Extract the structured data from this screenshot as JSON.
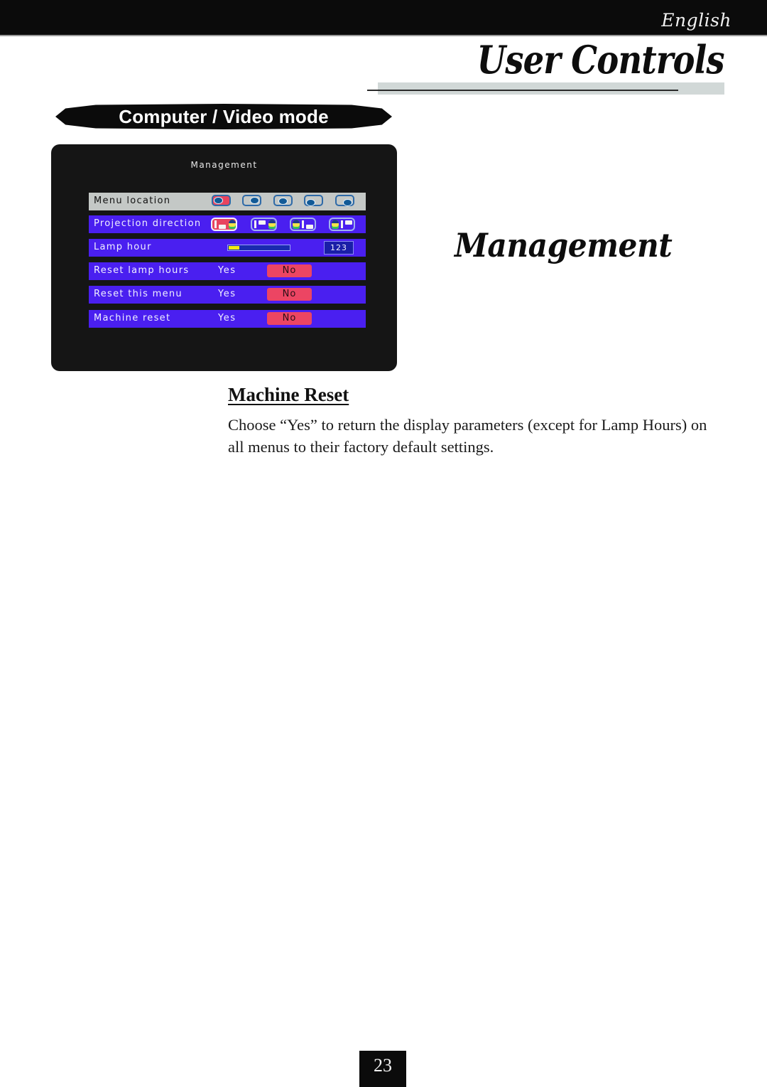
{
  "header": {
    "language": "English",
    "section_title": "User Controls"
  },
  "mode_banner": "Computer / Video mode",
  "osd": {
    "title": "Management",
    "rows": [
      {
        "label": "Menu location",
        "type": "icon-options",
        "selected": true,
        "options": [
          {
            "icon": "menu-location-top-left-icon",
            "active": true
          },
          {
            "icon": "menu-location-top-right-icon",
            "active": false
          },
          {
            "icon": "menu-location-center-icon",
            "active": false
          },
          {
            "icon": "menu-location-bottom-left-icon",
            "active": false
          },
          {
            "icon": "menu-location-bottom-right-icon",
            "active": false
          }
        ]
      },
      {
        "label": "Projection direction",
        "type": "icon-options",
        "selected": false,
        "options": [
          {
            "icon": "front-desktop-projection-icon",
            "active": true
          },
          {
            "icon": "front-ceiling-projection-icon",
            "active": false
          },
          {
            "icon": "rear-desktop-projection-icon",
            "active": false
          },
          {
            "icon": "rear-ceiling-projection-icon",
            "active": false
          }
        ]
      },
      {
        "label": "Lamp hour",
        "type": "meter",
        "value": "123",
        "fill_fraction": 0.18
      },
      {
        "label": "Reset lamp hours",
        "type": "yes-no",
        "yes": "Yes",
        "no": "No",
        "selected_option": "No"
      },
      {
        "label": "Reset this menu",
        "type": "yes-no",
        "yes": "Yes",
        "no": "No",
        "selected_option": "No"
      },
      {
        "label": "Machine reset",
        "type": "yes-no",
        "yes": "Yes",
        "no": "No",
        "selected_option": "No"
      }
    ]
  },
  "page_heading": "Management",
  "section": {
    "heading": "Machine Reset",
    "body": "Choose “Yes” to return the display parameters (except for Lamp Hours) on all menus to their factory default settings."
  },
  "page_number": "23",
  "colors": {
    "osd_background": "#151515",
    "row_blue": "#4a1ff0",
    "row_selected": "#c4c8c6",
    "option_active": "#ec4563",
    "lamp_fill": "#f2ec10"
  }
}
